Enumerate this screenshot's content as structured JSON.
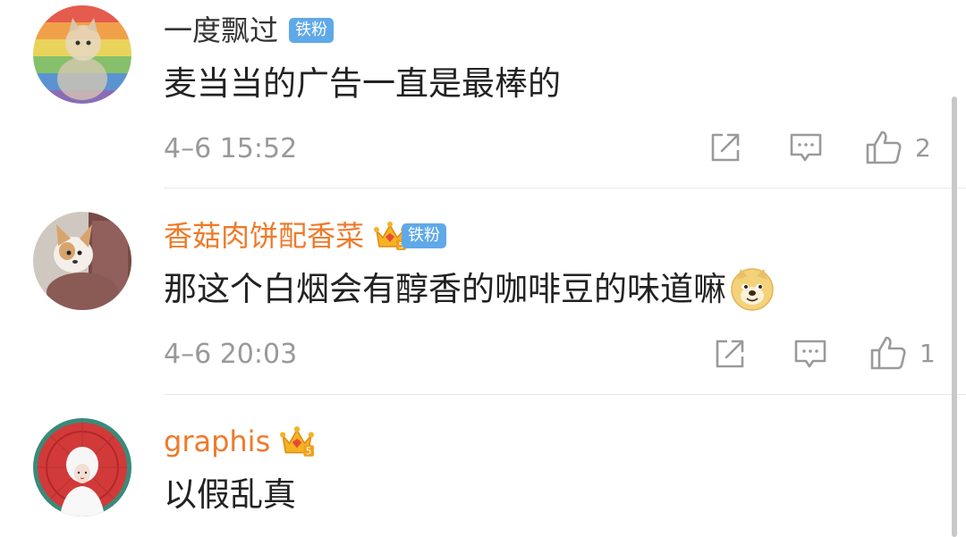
{
  "comments": [
    {
      "username": "一度飘过",
      "fan_badge": "铁粉",
      "text": "麦当当的广告一直是最棒的",
      "time": "4–6 15:52",
      "like_count": "2",
      "avatar_icon": "rainbow-cat-avatar"
    },
    {
      "username": "香菇肉饼配香菜",
      "fan_badge": "铁粉",
      "vip_level": "5",
      "text": "那这个白烟会有醇香的咖啡豆的味道嘛",
      "emoji": "doge-emoji",
      "time": "4–6 20:03",
      "like_count": "1",
      "avatar_icon": "corgi-puppy-avatar"
    },
    {
      "username": "graphis",
      "vip_level": "5",
      "text": "以假乱真",
      "avatar_icon": "bride-umbrella-avatar"
    }
  ],
  "colors": {
    "vip_name": "#ee7a2a",
    "fan_badge_bg": "#5fa9e8",
    "meta_text": "#999999",
    "icon_gray": "#999999"
  },
  "icons": {
    "share": "share-icon",
    "reply": "comment-icon",
    "like": "thumbs-up-icon",
    "vip": "crown-icon"
  }
}
